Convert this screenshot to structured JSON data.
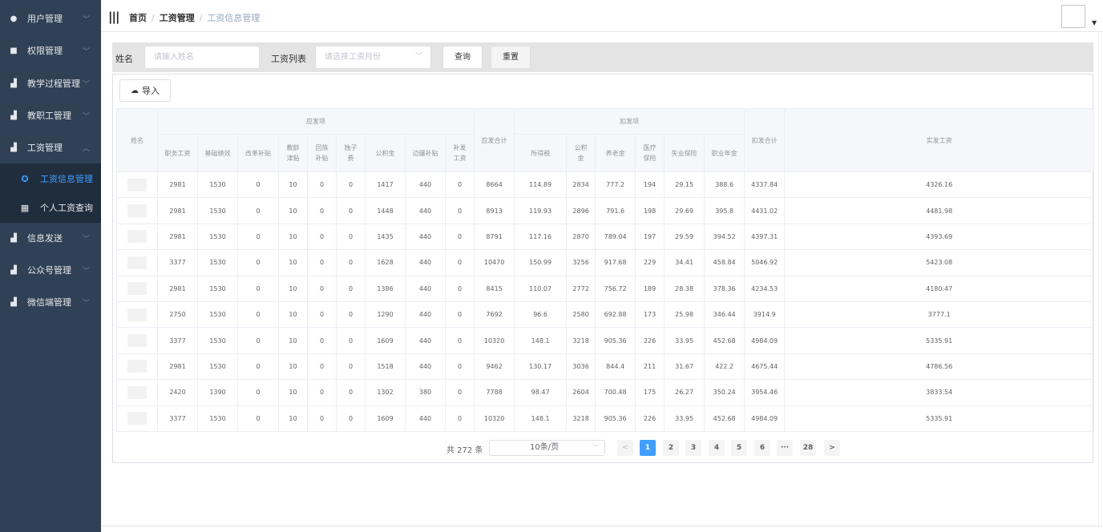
{
  "sidebar": {
    "items": [
      {
        "label": "用户管理",
        "icon": "user-icon",
        "arrow": "﹀"
      },
      {
        "label": "权限管理",
        "icon": "square-icon",
        "arrow": "﹀"
      },
      {
        "label": "教学过程管理",
        "icon": "bar-chart-icon",
        "arrow": "﹀"
      },
      {
        "label": "教职工管理",
        "icon": "bar-chart-icon",
        "arrow": "﹀"
      },
      {
        "label": "工资管理",
        "icon": "bar-chart-icon",
        "arrow": "︿"
      },
      {
        "label": "信息发送",
        "icon": "bar-chart-icon",
        "arrow": "﹀"
      },
      {
        "label": "公众号管理",
        "icon": "bar-chart-icon",
        "arrow": "﹀"
      },
      {
        "label": "微信端管理",
        "icon": "bar-chart-icon",
        "arrow": "﹀"
      }
    ],
    "subitems": [
      {
        "label": "工资信息管理",
        "icon": "circle-icon",
        "active": true
      },
      {
        "label": "个人工资查询",
        "icon": "grid-icon",
        "active": false
      }
    ]
  },
  "header": {
    "breadcrumb": [
      "首页",
      "工资管理",
      "工资信息管理"
    ]
  },
  "filter": {
    "name_label": "姓名",
    "name_placeholder": "请输入姓名",
    "list_label": "工资列表",
    "month_placeholder": "请选择工资月份",
    "search_label": "查询",
    "reset_label": "重置"
  },
  "toolbar": {
    "import_label": "导入"
  },
  "table": {
    "name_header": "姓名",
    "group_payable": "应发项",
    "group_deduct": "扣发项",
    "payable_cols": [
      "职务工资",
      "基础绩效",
      "改革补贴",
      "教龄津贴",
      "回族补贴",
      "独子费",
      "公积金",
      "边疆补贴",
      "补发工资"
    ],
    "payable_total": "应发合计",
    "deduct_cols": [
      "所得税",
      "公积金",
      "养老金",
      "医疗保险",
      "失业保险",
      "职业年金"
    ],
    "deduct_total": "扣发合计",
    "net": "实发工资",
    "rows": [
      [
        "2981",
        "1530",
        "0",
        "10",
        "0",
        "0",
        "1417",
        "440",
        "0",
        "8664",
        "114.89",
        "2834",
        "777.2",
        "194",
        "29.15",
        "388.6",
        "4337.84",
        "4326.16"
      ],
      [
        "2981",
        "1530",
        "0",
        "10",
        "0",
        "0",
        "1448",
        "440",
        "0",
        "8913",
        "119.93",
        "2896",
        "791.6",
        "198",
        "29.69",
        "395.8",
        "4431.02",
        "4481.98"
      ],
      [
        "2981",
        "1530",
        "0",
        "10",
        "0",
        "0",
        "1435",
        "440",
        "0",
        "8791",
        "117.16",
        "2870",
        "789.04",
        "197",
        "29.59",
        "394.52",
        "4397.31",
        "4393.69"
      ],
      [
        "3377",
        "1530",
        "0",
        "10",
        "0",
        "0",
        "1628",
        "440",
        "0",
        "10470",
        "150.99",
        "3256",
        "917.68",
        "229",
        "34.41",
        "458.84",
        "5046.92",
        "5423.08"
      ],
      [
        "2981",
        "1530",
        "0",
        "10",
        "0",
        "0",
        "1386",
        "440",
        "0",
        "8415",
        "110.07",
        "2772",
        "756.72",
        "189",
        "28.38",
        "378.36",
        "4234.53",
        "4180.47"
      ],
      [
        "2750",
        "1530",
        "0",
        "10",
        "0",
        "0",
        "1290",
        "440",
        "0",
        "7692",
        "96.6",
        "2580",
        "692.88",
        "173",
        "25.98",
        "346.44",
        "3914.9",
        "3777.1"
      ],
      [
        "3377",
        "1530",
        "0",
        "10",
        "0",
        "0",
        "1609",
        "440",
        "0",
        "10320",
        "148.1",
        "3218",
        "905.36",
        "226",
        "33.95",
        "452.68",
        "4984.09",
        "5335.91"
      ],
      [
        "2981",
        "1530",
        "0",
        "10",
        "0",
        "0",
        "1518",
        "440",
        "0",
        "9462",
        "130.17",
        "3036",
        "844.4",
        "211",
        "31.67",
        "422.2",
        "4675.44",
        "4786.56"
      ],
      [
        "2420",
        "1390",
        "0",
        "10",
        "0",
        "0",
        "1302",
        "380",
        "0",
        "7788",
        "98.47",
        "2604",
        "700.48",
        "175",
        "26.27",
        "350.24",
        "3954.46",
        "3833.54"
      ],
      [
        "3377",
        "1530",
        "0",
        "10",
        "0",
        "0",
        "1609",
        "440",
        "0",
        "10320",
        "148.1",
        "3218",
        "905.36",
        "226",
        "33.95",
        "452.68",
        "4984.09",
        "5335.91"
      ]
    ]
  },
  "pagination": {
    "total_text": "共 272 条",
    "page_size": "10条/页",
    "prev": "<",
    "next": ">",
    "pages": [
      "1",
      "2",
      "3",
      "4",
      "5",
      "6",
      "···",
      "28"
    ],
    "current": "1"
  },
  "colors": {
    "sidebar": "#304156",
    "accent": "#409eff"
  }
}
